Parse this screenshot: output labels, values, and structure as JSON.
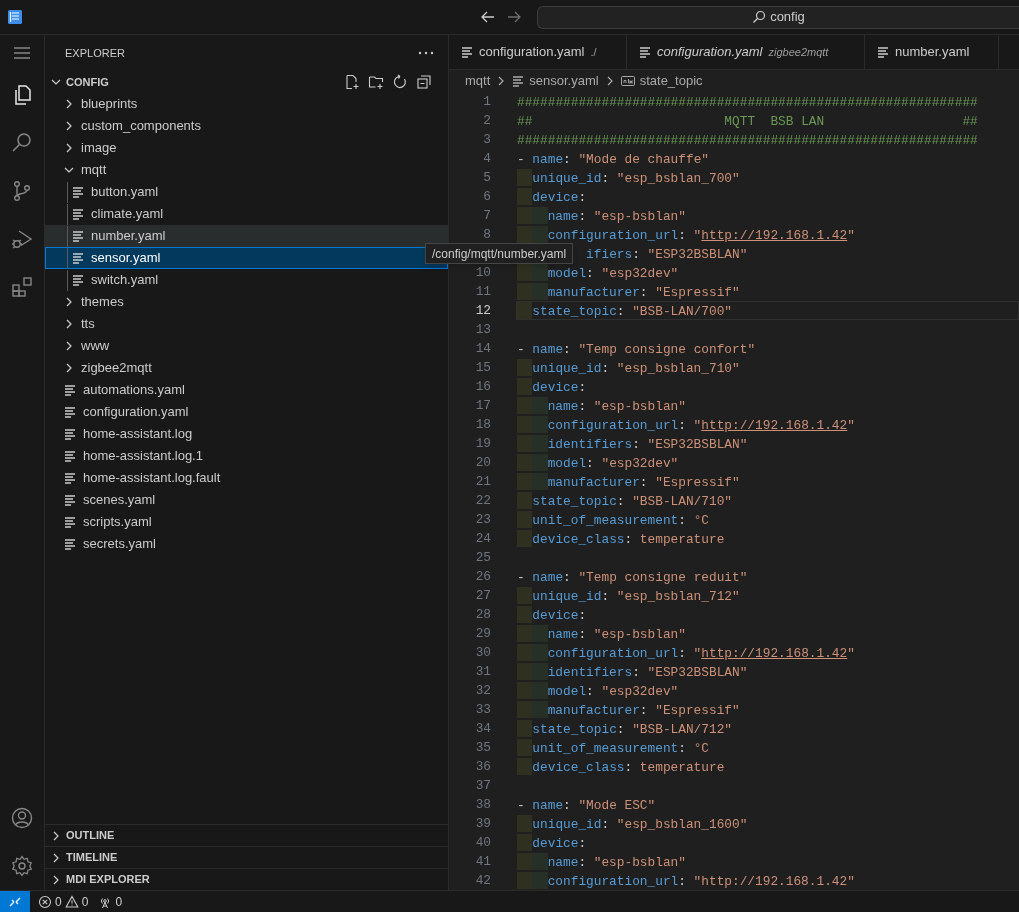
{
  "title_bar": {
    "search": "config"
  },
  "activity_bar": [
    {
      "kind": "menu",
      "selected": false
    },
    {
      "kind": "files",
      "selected": true
    },
    {
      "kind": "search",
      "selected": false
    },
    {
      "kind": "source",
      "selected": false
    },
    {
      "kind": "debug",
      "selected": false
    },
    {
      "kind": "extensions",
      "selected": false
    },
    {
      "kind": "account",
      "selected": false
    },
    {
      "kind": "settings",
      "selected": false
    }
  ],
  "sidebar": {
    "title": "EXPLORER",
    "root": {
      "label": "CONFIG",
      "expanded": true
    },
    "items": [
      {
        "label": "blueprints",
        "kind": "folder",
        "expanded": false,
        "selected": false,
        "hovered": false
      },
      {
        "label": "custom_components",
        "kind": "folder",
        "expanded": false,
        "selected": false,
        "hovered": false
      },
      {
        "label": "image",
        "kind": "folder",
        "expanded": false,
        "selected": false,
        "hovered": false
      },
      {
        "label": "mqtt",
        "kind": "folder",
        "expanded": true,
        "selected": false,
        "hovered": false,
        "children": [
          {
            "label": "button.yaml",
            "kind": "file",
            "selected": false,
            "hovered": false
          },
          {
            "label": "climate.yaml",
            "kind": "file",
            "selected": false,
            "hovered": false
          },
          {
            "label": "number.yaml",
            "kind": "file",
            "selected": false,
            "hovered": true
          },
          {
            "label": "sensor.yaml",
            "kind": "file",
            "selected": true,
            "hovered": false
          },
          {
            "label": "switch.yaml",
            "kind": "file",
            "selected": false,
            "hovered": false
          }
        ]
      },
      {
        "label": "themes",
        "kind": "folder",
        "expanded": false,
        "selected": false,
        "hovered": false
      },
      {
        "label": "tts",
        "kind": "folder",
        "expanded": false,
        "selected": false,
        "hovered": false
      },
      {
        "label": "www",
        "kind": "folder",
        "expanded": false,
        "selected": false,
        "hovered": false
      },
      {
        "label": "zigbee2mqtt",
        "kind": "folder",
        "expanded": false,
        "selected": false,
        "hovered": false
      },
      {
        "label": "automations.yaml",
        "kind": "file",
        "selected": false,
        "hovered": false
      },
      {
        "label": "configuration.yaml",
        "kind": "file",
        "selected": false,
        "hovered": false
      },
      {
        "label": "home-assistant.log",
        "kind": "file",
        "selected": false,
        "hovered": false
      },
      {
        "label": "home-assistant.log.1",
        "kind": "file",
        "selected": false,
        "hovered": false
      },
      {
        "label": "home-assistant.log.fault",
        "kind": "file",
        "selected": false,
        "hovered": false
      },
      {
        "label": "scenes.yaml",
        "kind": "file",
        "selected": false,
        "hovered": false
      },
      {
        "label": "scripts.yaml",
        "kind": "file",
        "selected": false,
        "hovered": false
      },
      {
        "label": "secrets.yaml",
        "kind": "file",
        "selected": false,
        "hovered": false
      }
    ],
    "sections": [
      {
        "label": "OUTLINE",
        "expanded": false
      },
      {
        "label": "TIMELINE",
        "expanded": false
      },
      {
        "label": "MDI EXPLORER",
        "expanded": false
      }
    ]
  },
  "tooltip": "/config/mqtt/number.yaml",
  "tabs": [
    {
      "label": "configuration.yaml",
      "description": "./",
      "preview": false,
      "selected": false
    },
    {
      "label": "configuration.yaml",
      "description": "zigbee2mqtt",
      "preview": true,
      "selected": false
    },
    {
      "label": "number.yaml",
      "preview": false,
      "selected": false
    }
  ],
  "breadcrumb": [
    {
      "kind": "folder",
      "label": "mqtt"
    },
    {
      "kind": "file",
      "label": "sensor.yaml"
    },
    {
      "kind": "symbol",
      "label": "state_topic"
    }
  ],
  "editor": {
    "lines": [
      {
        "number": "1",
        "kind": "top",
        "current": false,
        "tokens": [
          {
            "kind": "comment",
            "t": "############################################################"
          }
        ]
      },
      {
        "number": "2",
        "kind": "top",
        "current": false,
        "tokens": [
          {
            "kind": "comment",
            "t": "##                         MQTT  BSB LAN                  ##"
          }
        ]
      },
      {
        "number": "3",
        "kind": "top",
        "current": false,
        "tokens": [
          {
            "kind": "comment",
            "t": "############################################################"
          }
        ]
      },
      {
        "number": "4",
        "kind": "top",
        "current": false,
        "tokens": [
          {
            "kind": "punct",
            "t": "- "
          },
          {
            "kind": "key",
            "t": "name"
          },
          {
            "kind": "punct",
            "t": ": "
          },
          {
            "kind": "string",
            "t": "\"Mode de chauffe\""
          }
        ]
      },
      {
        "number": "5",
        "kind": "field",
        "current": false,
        "tokens": [
          {
            "kind": "key",
            "t": "unique_id"
          },
          {
            "kind": "punct",
            "t": ": "
          },
          {
            "kind": "string",
            "t": "\"esp_bsblan_700\""
          }
        ]
      },
      {
        "number": "6",
        "kind": "field",
        "current": false,
        "tokens": [
          {
            "kind": "key",
            "t": "device"
          },
          {
            "kind": "punct",
            "t": ":"
          }
        ]
      },
      {
        "number": "7",
        "kind": "sub",
        "current": false,
        "tokens": [
          {
            "kind": "key",
            "t": "name"
          },
          {
            "kind": "punct",
            "t": ": "
          },
          {
            "kind": "string",
            "t": "\"esp-bsblan\""
          }
        ]
      },
      {
        "number": "8",
        "kind": "sub",
        "current": false,
        "tokens": [
          {
            "kind": "key",
            "t": "configuration_url"
          },
          {
            "kind": "punct",
            "t": ": "
          },
          {
            "kind": "string",
            "t": "\""
          },
          {
            "kind": "url",
            "t": "http://192.168.1.42"
          },
          {
            "kind": "string",
            "t": "\""
          }
        ]
      },
      {
        "kind": "cut",
        "current": false,
        "tokens": [
          {
            "kind": "key",
            "t": "ifiers"
          },
          {
            "kind": "punct",
            "t": ": "
          },
          {
            "kind": "string",
            "t": "\"ESP32BSBLAN\""
          }
        ]
      },
      {
        "number": "10",
        "kind": "sub",
        "current": false,
        "tokens": [
          {
            "kind": "key",
            "t": "model"
          },
          {
            "kind": "punct",
            "t": ": "
          },
          {
            "kind": "string",
            "t": "\"esp32dev\""
          }
        ]
      },
      {
        "number": "11",
        "kind": "sub",
        "current": false,
        "tokens": [
          {
            "kind": "key",
            "t": "manufacturer"
          },
          {
            "kind": "punct",
            "t": ": "
          },
          {
            "kind": "string",
            "t": "\"Espressif\""
          }
        ]
      },
      {
        "number": "12",
        "kind": "field",
        "current": true,
        "tokens": [
          {
            "kind": "key",
            "t": "state_topic"
          },
          {
            "kind": "punct",
            "t": ": "
          },
          {
            "kind": "string",
            "t": "\"BSB-LAN/700\""
          }
        ]
      },
      {
        "number": "13",
        "kind": "blank",
        "current": false
      },
      {
        "number": "14",
        "kind": "top",
        "current": false,
        "tokens": [
          {
            "kind": "punct",
            "t": "- "
          },
          {
            "kind": "key",
            "t": "name"
          },
          {
            "kind": "punct",
            "t": ": "
          },
          {
            "kind": "string",
            "t": "\"Temp consigne confort\""
          }
        ]
      },
      {
        "number": "15",
        "kind": "field",
        "current": false,
        "tokens": [
          {
            "kind": "key",
            "t": "unique_id"
          },
          {
            "kind": "punct",
            "t": ": "
          },
          {
            "kind": "string",
            "t": "\"esp_bsblan_710\""
          }
        ]
      },
      {
        "number": "16",
        "kind": "field",
        "current": false,
        "tokens": [
          {
            "kind": "key",
            "t": "device"
          },
          {
            "kind": "punct",
            "t": ":"
          }
        ]
      },
      {
        "number": "17",
        "kind": "sub",
        "current": false,
        "tokens": [
          {
            "kind": "key",
            "t": "name"
          },
          {
            "kind": "punct",
            "t": ": "
          },
          {
            "kind": "string",
            "t": "\"esp-bsblan\""
          }
        ]
      },
      {
        "number": "18",
        "kind": "sub",
        "current": false,
        "tokens": [
          {
            "kind": "key",
            "t": "configuration_url"
          },
          {
            "kind": "punct",
            "t": ": "
          },
          {
            "kind": "string",
            "t": "\""
          },
          {
            "kind": "url",
            "t": "http://192.168.1.42"
          },
          {
            "kind": "string",
            "t": "\""
          }
        ]
      },
      {
        "number": "19",
        "kind": "sub",
        "current": false,
        "tokens": [
          {
            "kind": "key",
            "t": "identifiers"
          },
          {
            "kind": "punct",
            "t": ": "
          },
          {
            "kind": "string",
            "t": "\"ESP32BSBLAN\""
          }
        ]
      },
      {
        "number": "20",
        "kind": "sub",
        "current": false,
        "tokens": [
          {
            "kind": "key",
            "t": "model"
          },
          {
            "kind": "punct",
            "t": ": "
          },
          {
            "kind": "string",
            "t": "\"esp32dev\""
          }
        ]
      },
      {
        "number": "21",
        "kind": "sub",
        "current": false,
        "tokens": [
          {
            "kind": "key",
            "t": "manufacturer"
          },
          {
            "kind": "punct",
            "t": ": "
          },
          {
            "kind": "string",
            "t": "\"Espressif\""
          }
        ]
      },
      {
        "number": "22",
        "kind": "field",
        "current": false,
        "tokens": [
          {
            "kind": "key",
            "t": "state_topic"
          },
          {
            "kind": "punct",
            "t": ": "
          },
          {
            "kind": "string",
            "t": "\"BSB-LAN/710\""
          }
        ]
      },
      {
        "number": "23",
        "kind": "field",
        "current": false,
        "tokens": [
          {
            "kind": "key",
            "t": "unit_of_measurement"
          },
          {
            "kind": "punct",
            "t": ": "
          },
          {
            "kind": "value",
            "t": "°C"
          }
        ]
      },
      {
        "number": "24",
        "kind": "field",
        "current": false,
        "tokens": [
          {
            "kind": "key",
            "t": "device_class"
          },
          {
            "kind": "punct",
            "t": ": "
          },
          {
            "kind": "value",
            "t": "temperature"
          }
        ]
      },
      {
        "number": "25",
        "kind": "blank",
        "current": false
      },
      {
        "number": "26",
        "kind": "top",
        "current": false,
        "tokens": [
          {
            "kind": "punct",
            "t": "- "
          },
          {
            "kind": "key",
            "t": "name"
          },
          {
            "kind": "punct",
            "t": ": "
          },
          {
            "kind": "string",
            "t": "\"Temp consigne reduit\""
          }
        ]
      },
      {
        "number": "27",
        "kind": "field",
        "current": false,
        "tokens": [
          {
            "kind": "key",
            "t": "unique_id"
          },
          {
            "kind": "punct",
            "t": ": "
          },
          {
            "kind": "string",
            "t": "\"esp_bsblan_712\""
          }
        ]
      },
      {
        "number": "28",
        "kind": "field",
        "current": false,
        "tokens": [
          {
            "kind": "key",
            "t": "device"
          },
          {
            "kind": "punct",
            "t": ":"
          }
        ]
      },
      {
        "number": "29",
        "kind": "sub",
        "current": false,
        "tokens": [
          {
            "kind": "key",
            "t": "name"
          },
          {
            "kind": "punct",
            "t": ": "
          },
          {
            "kind": "string",
            "t": "\"esp-bsblan\""
          }
        ]
      },
      {
        "number": "30",
        "kind": "sub",
        "current": false,
        "tokens": [
          {
            "kind": "key",
            "t": "configuration_url"
          },
          {
            "kind": "punct",
            "t": ": "
          },
          {
            "kind": "string",
            "t": "\""
          },
          {
            "kind": "url",
            "t": "http://192.168.1.42"
          },
          {
            "kind": "string",
            "t": "\""
          }
        ]
      },
      {
        "number": "31",
        "kind": "sub",
        "current": false,
        "tokens": [
          {
            "kind": "key",
            "t": "identifiers"
          },
          {
            "kind": "punct",
            "t": ": "
          },
          {
            "kind": "string",
            "t": "\"ESP32BSBLAN\""
          }
        ]
      },
      {
        "number": "32",
        "kind": "sub",
        "current": false,
        "tokens": [
          {
            "kind": "key",
            "t": "model"
          },
          {
            "kind": "punct",
            "t": ": "
          },
          {
            "kind": "string",
            "t": "\"esp32dev\""
          }
        ]
      },
      {
        "number": "33",
        "kind": "sub",
        "current": false,
        "tokens": [
          {
            "kind": "key",
            "t": "manufacturer"
          },
          {
            "kind": "punct",
            "t": ": "
          },
          {
            "kind": "string",
            "t": "\"Espressif\""
          }
        ]
      },
      {
        "number": "34",
        "kind": "field",
        "current": false,
        "tokens": [
          {
            "kind": "key",
            "t": "state_topic"
          },
          {
            "kind": "punct",
            "t": ": "
          },
          {
            "kind": "string",
            "t": "\"BSB-LAN/712\""
          }
        ]
      },
      {
        "number": "35",
        "kind": "field",
        "current": false,
        "tokens": [
          {
            "kind": "key",
            "t": "unit_of_measurement"
          },
          {
            "kind": "punct",
            "t": ": "
          },
          {
            "kind": "value",
            "t": "°C"
          }
        ]
      },
      {
        "number": "36",
        "kind": "field",
        "current": false,
        "tokens": [
          {
            "kind": "key",
            "t": "device_class"
          },
          {
            "kind": "punct",
            "t": ": "
          },
          {
            "kind": "value",
            "t": "temperature"
          }
        ]
      },
      {
        "number": "37",
        "kind": "blank",
        "current": false
      },
      {
        "number": "38",
        "kind": "top",
        "current": false,
        "tokens": [
          {
            "kind": "punct",
            "t": "- "
          },
          {
            "kind": "key",
            "t": "name"
          },
          {
            "kind": "punct",
            "t": ": "
          },
          {
            "kind": "string",
            "t": "\"Mode ESC\""
          }
        ]
      },
      {
        "number": "39",
        "kind": "field",
        "current": false,
        "tokens": [
          {
            "kind": "key",
            "t": "unique_id"
          },
          {
            "kind": "punct",
            "t": ": "
          },
          {
            "kind": "string",
            "t": "\"esp_bsblan_1600\""
          }
        ]
      },
      {
        "number": "40",
        "kind": "field",
        "current": false,
        "tokens": [
          {
            "kind": "key",
            "t": "device"
          },
          {
            "kind": "punct",
            "t": ":"
          }
        ]
      },
      {
        "number": "41",
        "kind": "sub",
        "current": false,
        "tokens": [
          {
            "kind": "key",
            "t": "name"
          },
          {
            "kind": "punct",
            "t": ": "
          },
          {
            "kind": "string",
            "t": "\"esp-bsblan\""
          }
        ]
      },
      {
        "number": "42",
        "kind": "sub",
        "current": false,
        "tokens": [
          {
            "kind": "key",
            "t": "configuration_url"
          },
          {
            "kind": "punct",
            "t": ": "
          },
          {
            "kind": "string",
            "t": "\"http://192.168.1.42\""
          }
        ]
      }
    ]
  },
  "status_bar": {
    "errors": "0",
    "warnings": "0",
    "ports": "0"
  }
}
